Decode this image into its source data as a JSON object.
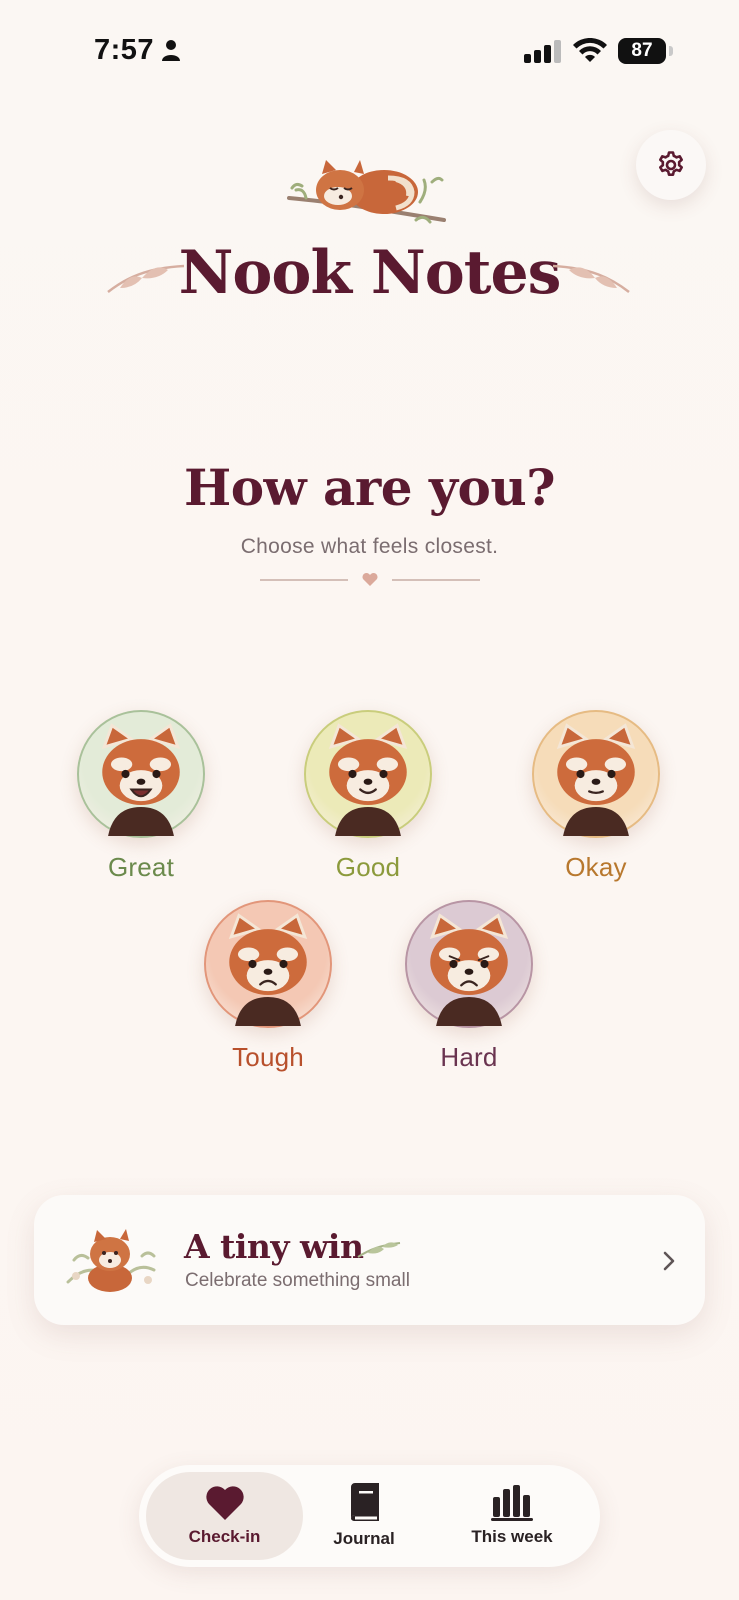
{
  "status_bar": {
    "time": "7:57",
    "battery": "87"
  },
  "header": {
    "app_title": "Nook Notes",
    "settings_icon": "gear-icon"
  },
  "prompt": {
    "question": "How are you?",
    "subtitle": "Choose what feels closest."
  },
  "moods": [
    {
      "label": "Great",
      "color": "#6b8a4c",
      "ring": "#a9c19a",
      "bg": "#e3ebd8",
      "expression": "laughing"
    },
    {
      "label": "Good",
      "color": "#8c9a3c",
      "ring": "#c9cd7c",
      "bg": "#eceab8",
      "expression": "smiling"
    },
    {
      "label": "Okay",
      "color": "#b8782e",
      "ring": "#e6bb83",
      "bg": "#f6dcb9",
      "expression": "neutral"
    },
    {
      "label": "Tough",
      "color": "#b8502c",
      "ring": "#e2967a",
      "bg": "#f4c8b4",
      "expression": "frowning"
    },
    {
      "label": "Hard",
      "color": "#6a3450",
      "ring": "#b895a4",
      "bg": "#dccad3",
      "expression": "sad"
    }
  ],
  "tiny_win": {
    "title": "A tiny win",
    "subtitle": "Celebrate something small"
  },
  "nav": {
    "items": [
      {
        "label": "Check-in",
        "icon": "heart-icon",
        "active": true
      },
      {
        "label": "Journal",
        "icon": "book-icon",
        "active": false
      },
      {
        "label": "This week",
        "icon": "bar-chart-icon",
        "active": false
      }
    ]
  },
  "colors": {
    "brand": "#5a1a30",
    "muted_text": "#7b6d70",
    "background": "#fbf7f3"
  }
}
